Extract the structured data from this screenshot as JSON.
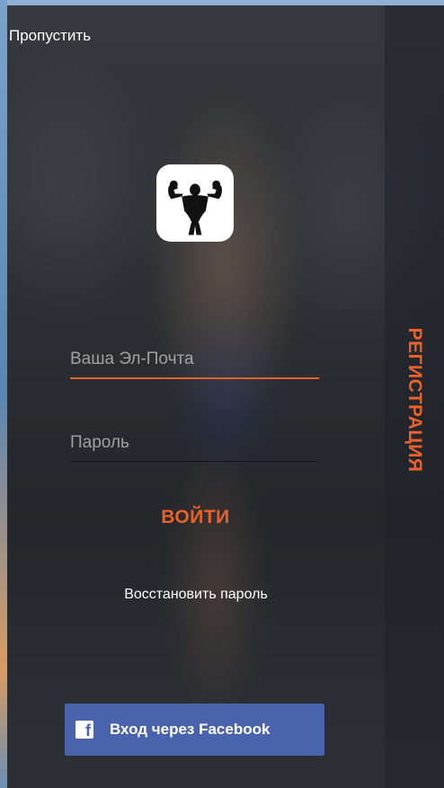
{
  "top_bar": {
    "skip_label": "Пропустить"
  },
  "logo": {
    "icon": "bodybuilder-icon"
  },
  "login_form": {
    "email_placeholder": "Ваша Эл-Почта",
    "email_value": "",
    "password_placeholder": "Пароль",
    "password_value": "",
    "login_label": "ВОЙТИ",
    "restore_label": "Восстановить пароль"
  },
  "facebook": {
    "icon": "facebook-icon",
    "label": "Вход через Facebook"
  },
  "side": {
    "register_label": "РЕГИСТРАЦИЯ"
  },
  "colors": {
    "accent": "#e8622a",
    "facebook": "#4a63ad"
  }
}
